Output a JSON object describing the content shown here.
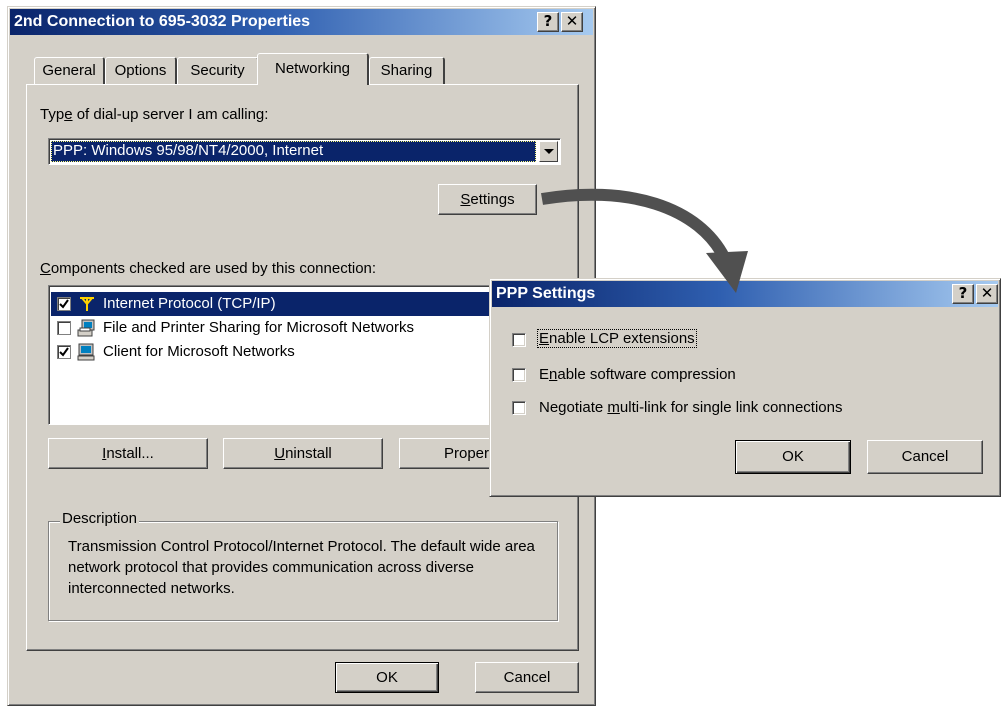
{
  "main_dialog": {
    "title": "2nd Connection to 695-3032 Properties",
    "help_glyph": "?",
    "close_glyph": "✕",
    "tabs": [
      {
        "label": "General"
      },
      {
        "label": "Options"
      },
      {
        "label": "Security"
      },
      {
        "label": "Networking"
      },
      {
        "label": "Sharing"
      }
    ],
    "server_type_label": {
      "before": "Typ",
      "mnemonic": "e",
      "after": " of dial-up server I am calling:"
    },
    "server_type_value": "PPP: Windows 95/98/NT4/2000, Internet",
    "settings_button": {
      "mnemonic": "S",
      "rest": "ettings"
    },
    "components_label": {
      "mnemonic": "C",
      "rest": "omponents checked are used by this connection:"
    },
    "components": [
      {
        "label": "Internet Protocol (TCP/IP)",
        "checked": true,
        "selected": true,
        "icon": "network-protocol-icon"
      },
      {
        "label": "File and Printer Sharing for Microsoft Networks",
        "checked": false,
        "selected": false,
        "icon": "file-printer-sharing-icon"
      },
      {
        "label": "Client for Microsoft Networks",
        "checked": true,
        "selected": false,
        "icon": "network-client-icon"
      }
    ],
    "install_button": {
      "mnemonic": "I",
      "rest": "nstall..."
    },
    "uninstall_button": {
      "mnemonic": "U",
      "rest": "ninstall"
    },
    "properties_button": "Proper",
    "description_legend": "Description",
    "description_text": "Transmission Control Protocol/Internet Protocol. The default wide area network protocol that provides communication across diverse interconnected networks.",
    "ok_button": "OK",
    "cancel_button": "Cancel"
  },
  "ppp_dialog": {
    "title": "PPP Settings",
    "help_glyph": "?",
    "close_glyph": "✕",
    "options": [
      {
        "before": "",
        "mnemonic": "E",
        "after": "nable LCP extensions",
        "checked": false
      },
      {
        "before": "E",
        "mnemonic": "n",
        "after": "able software compression",
        "checked": false
      },
      {
        "before": "Negotiate ",
        "mnemonic": "m",
        "after": "ulti-link for single link connections",
        "checked": false
      }
    ],
    "ok_button": "OK",
    "cancel_button": "Cancel"
  },
  "colors": {
    "dialog_face": "#d4d0c8",
    "titlebar_start": "#0a246a",
    "titlebar_end": "#a6caf0",
    "selection": "#0a246a",
    "arrow": "#505050"
  }
}
